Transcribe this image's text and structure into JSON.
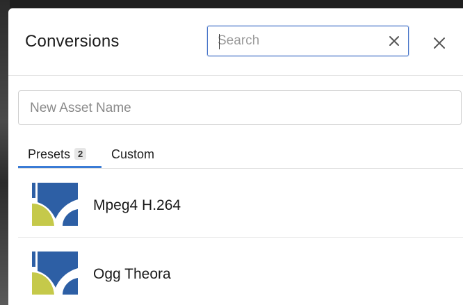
{
  "dialog": {
    "title": "Conversions",
    "search": {
      "placeholder": "Search",
      "value": ""
    },
    "clear_icon": "x-icon",
    "close_icon": "close-icon"
  },
  "asset_name": {
    "placeholder": "New Asset Name",
    "value": ""
  },
  "tabs": [
    {
      "label": "Presets",
      "badge": "2",
      "active": true
    },
    {
      "label": "Custom",
      "active": false
    }
  ],
  "presets": [
    {
      "label": "Mpeg4 H.264",
      "icon": "preset-logo-icon"
    },
    {
      "label": "Ogg Theora",
      "icon": "preset-logo-icon"
    }
  ],
  "colors": {
    "accent": "#3a7bd5",
    "logo_blue": "#2d5fa5",
    "logo_green": "#c5c94a"
  }
}
